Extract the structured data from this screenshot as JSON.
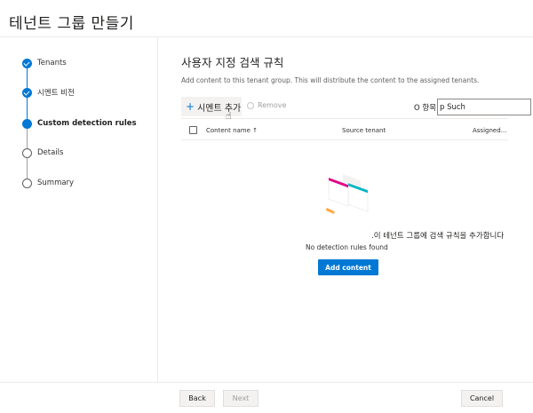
{
  "header": {
    "title": "테넌트 그룹 만들기"
  },
  "steps": [
    {
      "label": "Tenants",
      "state": "done"
    },
    {
      "label": "시멘트 비전",
      "state": "done"
    },
    {
      "label": "Custom detection rules",
      "state": "current"
    },
    {
      "label": "Details",
      "state": "todo"
    },
    {
      "label": "Summary",
      "state": "todo"
    }
  ],
  "main": {
    "title": "사용자 지정 검색 규칙",
    "description": "Add content to this tenant group. This will distribute the content to the assigned tenants.",
    "toolbar": {
      "add_label": "시멘트 추가",
      "remove_label": "Remove",
      "search_label": "O 항목",
      "search_value": "p Such"
    },
    "table": {
      "columns": [
        "Content name ↑",
        "Source tenant",
        "Assigned..."
      ]
    },
    "empty": {
      "overlay_text": ".이 테넌트 그룹에 검색 규칙을 추가합니다",
      "message": "No detection rules found",
      "button_label": "Add content"
    }
  },
  "footer": {
    "back_label": "Back",
    "next_label": "Next",
    "cancel_label": "Cancel"
  },
  "colors": {
    "accent": "#0078d4",
    "illus_pink": "#e3008c",
    "illus_cyan": "#00b7c3",
    "illus_orange": "#ffaa44"
  }
}
